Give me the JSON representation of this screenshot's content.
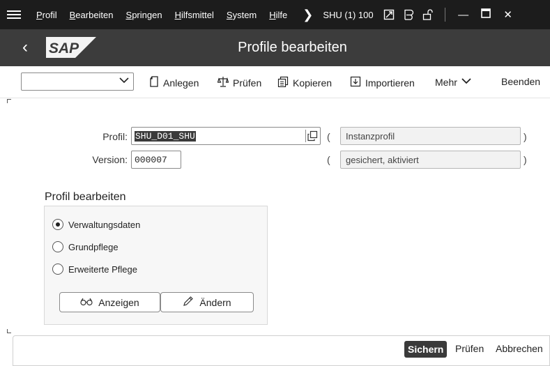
{
  "menubar": {
    "items": [
      "Profil",
      "Bearbeiten",
      "Springen",
      "Hilfsmittel",
      "System",
      "Hilfe"
    ],
    "system_info": "SHU (1) 100",
    "icons": [
      "hamburger-icon",
      "chevron-right-icon",
      "transaction-icon",
      "layout-icon",
      "lock-icon",
      "minimize-icon",
      "maximize-icon",
      "close-icon"
    ]
  },
  "titlebar": {
    "logo_text": "SAP",
    "title": "Profile bearbeiten"
  },
  "toolbar": {
    "combo_value": "",
    "anlegen": "Anlegen",
    "pruefen": "Prüfen",
    "kopieren": "Kopieren",
    "importieren": "Importieren",
    "mehr": "Mehr",
    "beenden": "Beenden"
  },
  "form": {
    "profil_label": "Profil:",
    "profil_value": "SHU_D01_SHU",
    "profil_desc": "Instanzprofil",
    "version_label": "Version:",
    "version_value": "000007",
    "version_desc": "gesichert, aktiviert",
    "open_paren": "(",
    "close_paren": ")"
  },
  "group": {
    "title": "Profil bearbeiten",
    "options": [
      "Verwaltungsdaten",
      "Grundpflege",
      "Erweiterte Pflege"
    ],
    "selected_index": 0,
    "anzeigen": "Anzeigen",
    "aendern": "Ändern"
  },
  "footer": {
    "sichern": "Sichern",
    "pruefen": "Prüfen",
    "abbrechen": "Abbrechen"
  },
  "colors": {
    "menubar_bg": "#1c1c1c",
    "titlebar_bg": "#3c3c3c",
    "primary_button": "#3a3a3a"
  }
}
